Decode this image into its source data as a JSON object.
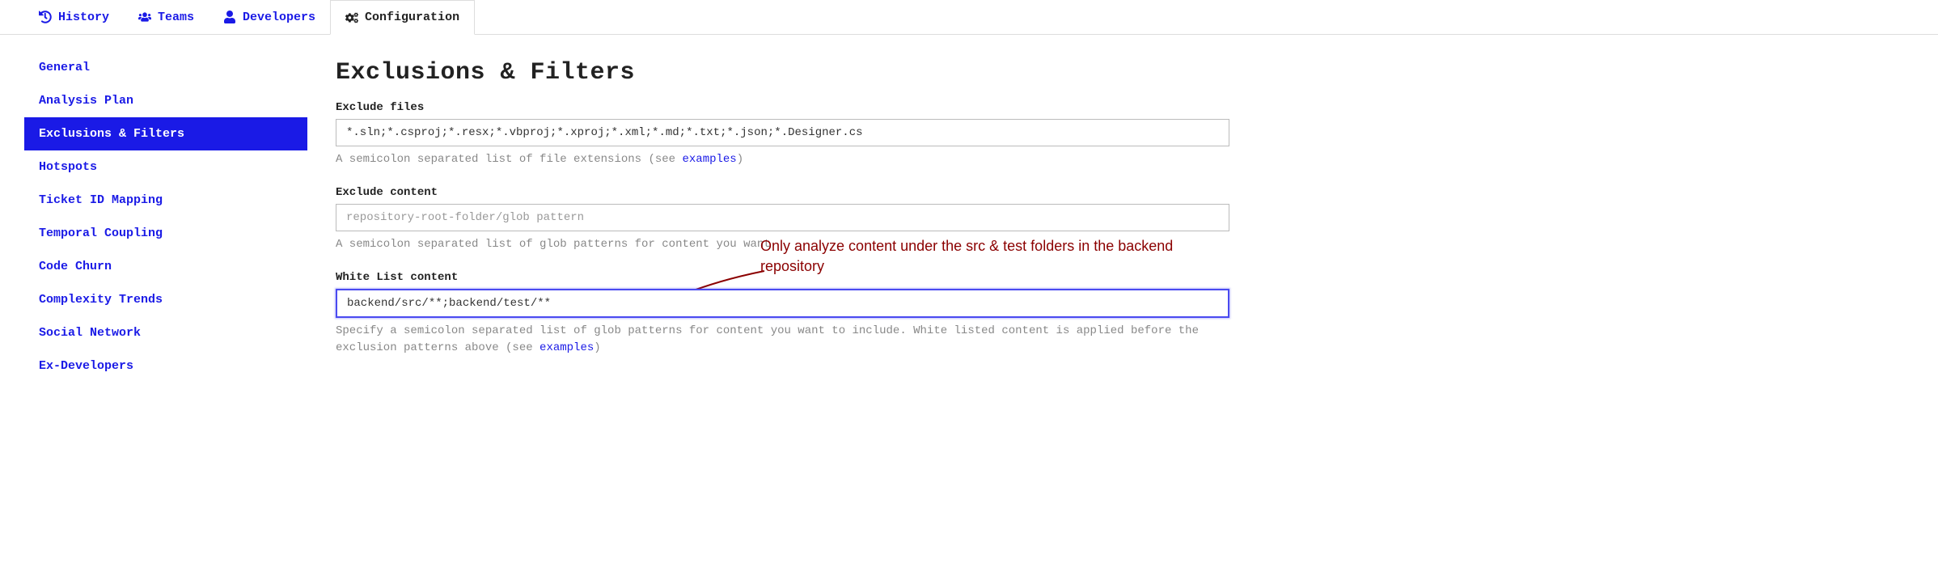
{
  "tabs": [
    {
      "label": "History"
    },
    {
      "label": "Teams"
    },
    {
      "label": "Developers"
    },
    {
      "label": "Configuration"
    }
  ],
  "sidebar": {
    "items": [
      {
        "label": "General"
      },
      {
        "label": "Analysis Plan"
      },
      {
        "label": "Exclusions & Filters"
      },
      {
        "label": "Hotspots"
      },
      {
        "label": "Ticket ID Mapping"
      },
      {
        "label": "Temporal Coupling"
      },
      {
        "label": "Code Churn"
      },
      {
        "label": "Complexity Trends"
      },
      {
        "label": "Social Network"
      },
      {
        "label": "Ex-Developers"
      }
    ]
  },
  "page": {
    "title": "Exclusions & Filters",
    "exclude_files": {
      "label": "Exclude files",
      "value": "*.sln;*.csproj;*.resx;*.vbproj;*.xproj;*.xml;*.md;*.txt;*.json;*.Designer.cs",
      "help_prefix": "A semicolon separated list of file extensions (see ",
      "help_link": "examples",
      "help_suffix": ")"
    },
    "exclude_content": {
      "label": "Exclude content",
      "placeholder": "repository-root-folder/glob pattern",
      "help": "A semicolon separated list of glob patterns for content you want"
    },
    "whitelist": {
      "label": "White List content",
      "value": "backend/src/**;backend/test/**",
      "help_prefix": "Specify a semicolon separated list of glob patterns for content you want to include. White listed content is applied before the exclusion patterns above (see ",
      "help_link": "examples",
      "help_suffix": ")"
    }
  },
  "annotation": {
    "text": "Only analyze content under the src & test folders in the backend repository"
  }
}
